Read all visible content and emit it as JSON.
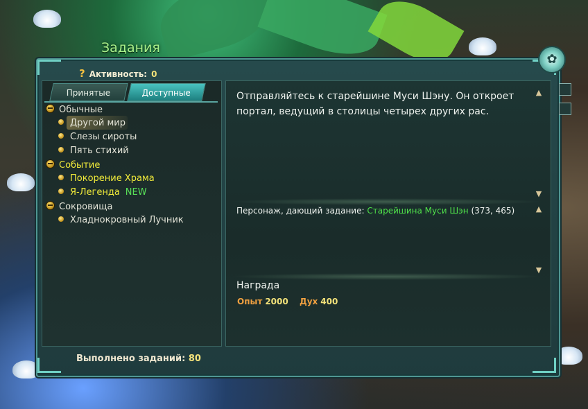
{
  "window": {
    "title": "Задания"
  },
  "activity": {
    "label": "Активность:",
    "value": "0"
  },
  "tabs": [
    {
      "label": "Принятые",
      "active": false
    },
    {
      "label": "Доступные",
      "active": true
    }
  ],
  "quest_list": {
    "categories": [
      {
        "label": "Обычные",
        "color": "#e4e4d8",
        "items": [
          {
            "label": "Другой мир",
            "selected": true
          },
          {
            "label": "Слезы сироты"
          },
          {
            "label": "Пять стихий"
          }
        ]
      },
      {
        "label": "Событие",
        "color": "#f0ea3a",
        "items": [
          {
            "label": "Покорение Храма"
          },
          {
            "label": "Я-Легенда",
            "badge": "NEW"
          }
        ]
      },
      {
        "label": "Сокровища",
        "color": "#e4e4d8",
        "items": [
          {
            "label": "Хладнокровный Лучник"
          }
        ]
      }
    ]
  },
  "completed": {
    "label": "Выполнено заданий:",
    "value": "80"
  },
  "details": {
    "description": "Отправляйтесь к старейшине Муси Шэну. Он откроет портал, ведущий в столицы четырех других рас.",
    "giver_label": "Персонаж, дающий задание:",
    "giver_name": "Старейшина Муси Шэн",
    "giver_coords": "(373, 465)",
    "reward_title": "Награда",
    "rewards": [
      {
        "label": "Опыт",
        "value": "2000"
      },
      {
        "label": "Дух",
        "value": "400"
      }
    ]
  },
  "colors": {
    "accent": "#4fe04a",
    "event": "#f0ea3a",
    "value": "#f3e27a",
    "reward_label": "#f0a040"
  }
}
